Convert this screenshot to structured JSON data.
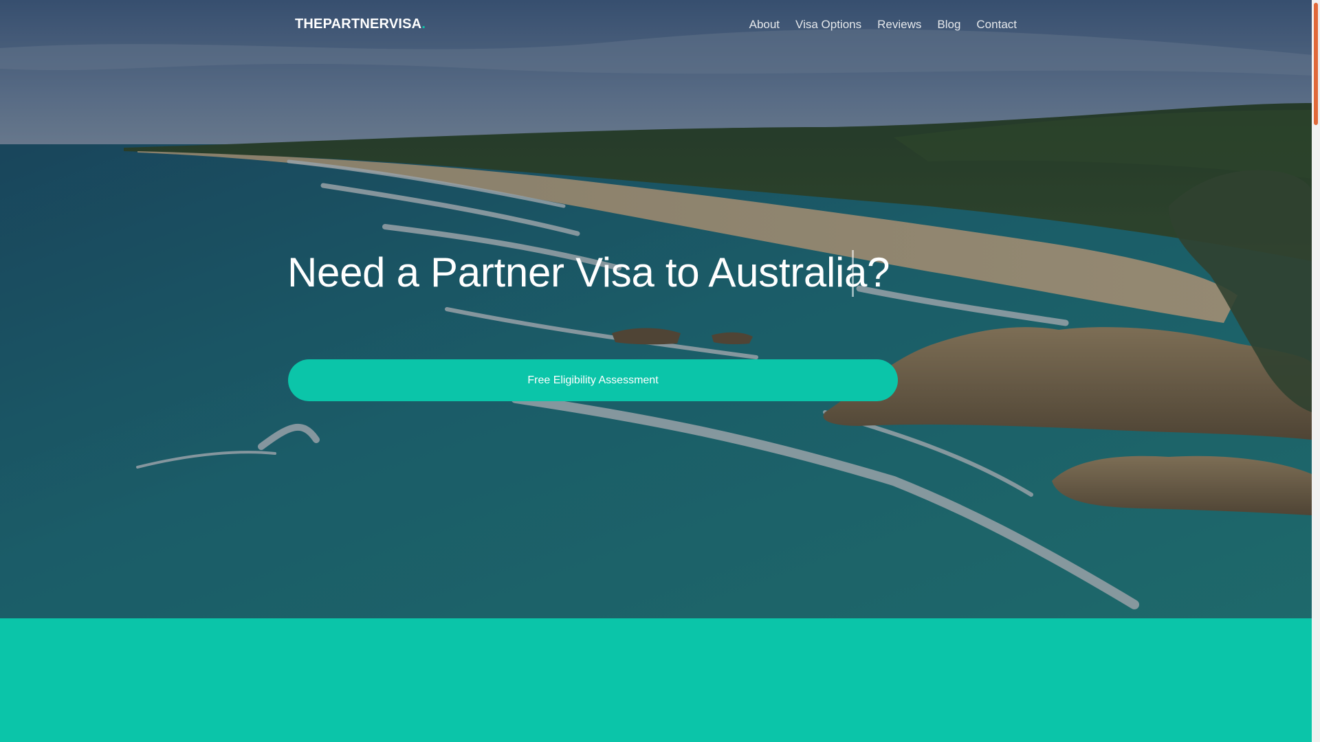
{
  "brand": {
    "name": "THEPARTNERVISA",
    "dot": "."
  },
  "nav": {
    "items": [
      {
        "label": "About"
      },
      {
        "label": "Visa Options"
      },
      {
        "label": "Reviews"
      },
      {
        "label": "Blog"
      },
      {
        "label": "Contact"
      }
    ]
  },
  "hero": {
    "headline": "Need a Partner Visa to Australia?",
    "cta_label": "Free Eligibility Assessment",
    "background_image": "aerial-beach-coastline"
  },
  "colors": {
    "accent": "#0bc5a9",
    "scroll_thumb": "#e0693a"
  }
}
